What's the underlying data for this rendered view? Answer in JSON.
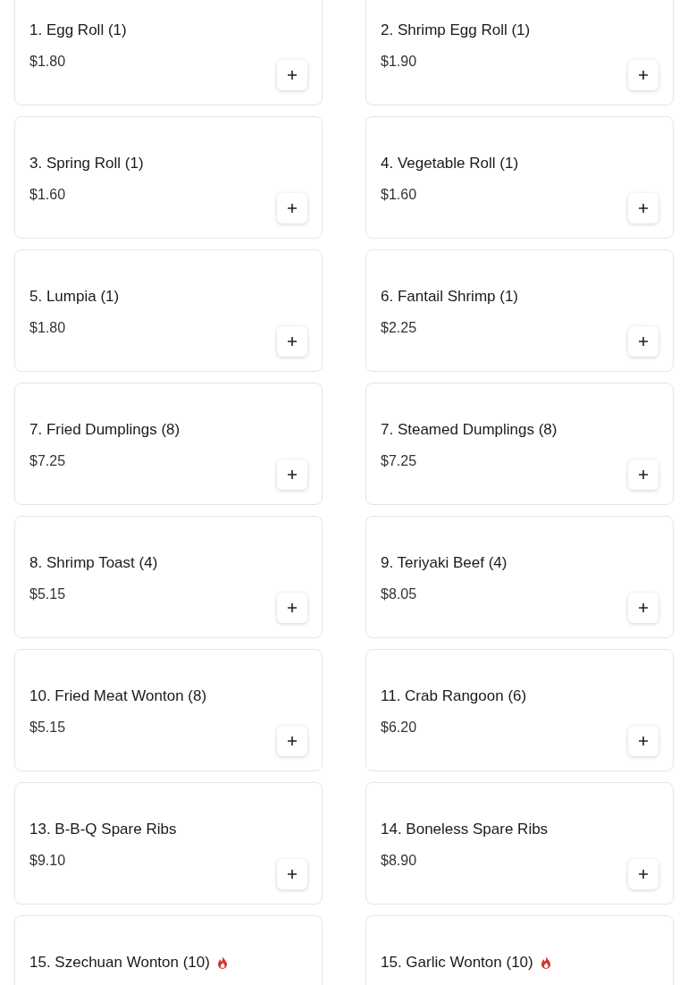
{
  "items": [
    {
      "name": "1. Egg Roll (1)",
      "price": "$1.80",
      "spicy": false
    },
    {
      "name": "2. Shrimp Egg Roll (1)",
      "price": "$1.90",
      "spicy": false
    },
    {
      "name": "3. Spring Roll (1)",
      "price": "$1.60",
      "spicy": false
    },
    {
      "name": "4. Vegetable Roll (1)",
      "price": "$1.60",
      "spicy": false
    },
    {
      "name": "5. Lumpia (1)",
      "price": "$1.80",
      "spicy": false
    },
    {
      "name": "6. Fantail Shrimp (1)",
      "price": "$2.25",
      "spicy": false
    },
    {
      "name": "7. Fried Dumplings (8)",
      "price": "$7.25",
      "spicy": false
    },
    {
      "name": "7. Steamed Dumplings (8)",
      "price": "$7.25",
      "spicy": false
    },
    {
      "name": "8. Shrimp Toast (4)",
      "price": "$5.15",
      "spicy": false
    },
    {
      "name": "9. Teriyaki Beef (4)",
      "price": "$8.05",
      "spicy": false
    },
    {
      "name": "10. Fried Meat Wonton (8)",
      "price": "$5.15",
      "spicy": false
    },
    {
      "name": "11. Crab Rangoon (6)",
      "price": "$6.20",
      "spicy": false
    },
    {
      "name": "13. B-B-Q Spare Ribs",
      "price": "$9.10",
      "spicy": false
    },
    {
      "name": "14. Boneless Spare Ribs",
      "price": "$8.90",
      "spicy": false
    },
    {
      "name": "15. Szechuan Wonton (10)",
      "spicy": true
    },
    {
      "name": "15. Garlic Wonton (10)",
      "spicy": true
    }
  ]
}
